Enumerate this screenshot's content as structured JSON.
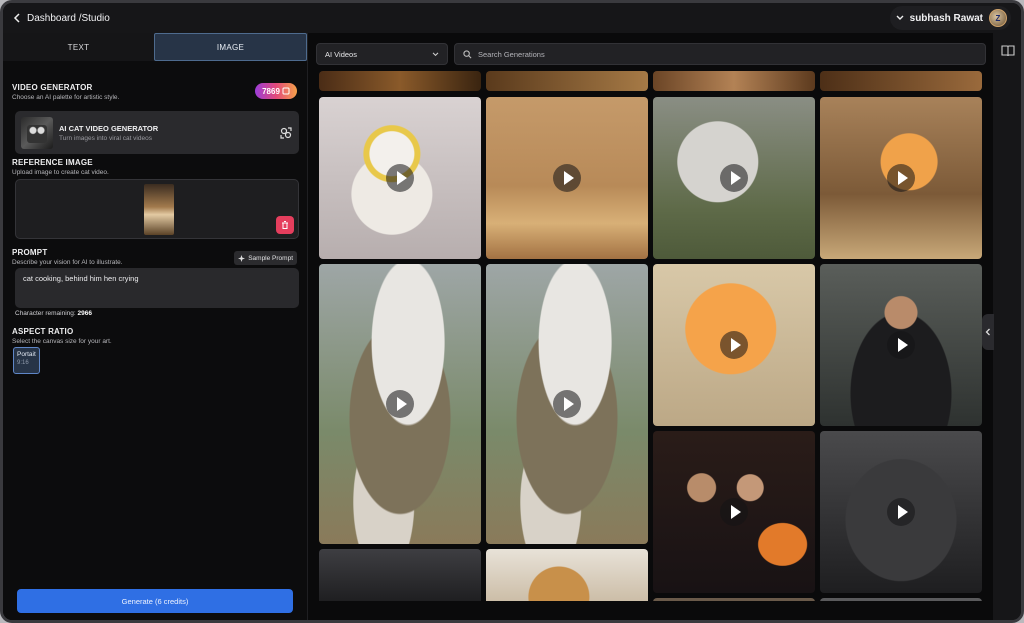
{
  "header": {
    "breadcrumb": "Dashboard /Studio",
    "user_name": "subhash Rawat",
    "avatar_letter": "Z"
  },
  "tabs": [
    {
      "label": "TEXT",
      "active": false
    },
    {
      "label": "IMAGE",
      "active": true
    }
  ],
  "video_generator": {
    "title": "VIDEO GENERATOR",
    "subtitle": "Choose an AI palette for artistic style.",
    "credits": "7869",
    "name": "AI CAT VIDEO GENERATOR",
    "description": "Turn images into viral cat videos"
  },
  "reference_image": {
    "title": "REFERENCE IMAGE",
    "subtitle": "Upload image to create cat video."
  },
  "prompt": {
    "title": "PROMPT",
    "subtitle": "Describe your vision for AI to illustrate.",
    "sample_label": "Sample Prompt",
    "value": "cat cooking, behind him hen crying",
    "chars_label": "Character remaining:",
    "chars_value": "2966"
  },
  "aspect": {
    "title": "ASPECT RATIO",
    "subtitle": "Select the canvas size for your art.",
    "option_label": "Portait",
    "option_ratio": "9:16"
  },
  "generate_label": "Generate (6 credits)",
  "filter": {
    "selected": "AI Videos",
    "search_placeholder": "Search Generations"
  },
  "colors": {
    "accent": "#2f6fe4",
    "tab_active": "#273447",
    "trash": "#e53e5d"
  }
}
